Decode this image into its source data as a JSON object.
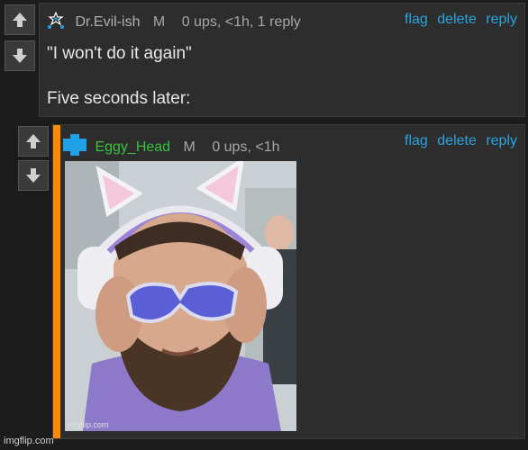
{
  "comment1": {
    "username": "Dr.Evil-ish",
    "badge": "M",
    "stats": "0 ups, <1h, 1 reply",
    "line1": "\"I won't do it again\"",
    "line2": "Five seconds later:",
    "actions": {
      "flag": "flag",
      "delete": "delete",
      "reply": "reply"
    }
  },
  "comment2": {
    "username": "Eggy_Head",
    "badge": "M",
    "stats": "0 ups, <1h",
    "actions": {
      "flag": "flag",
      "delete": "delete",
      "reply": "reply"
    },
    "image_watermark": "imgflip.com"
  },
  "footer": {
    "watermark": "imgflip.com"
  },
  "icons": {
    "upvote": "arrow-up-icon",
    "downvote": "arrow-down-icon",
    "avatar1": "star-cluster-icon",
    "avatar2": "plus-shape-icon"
  },
  "colors": {
    "link": "#2aa3e0",
    "username2": "#39c23e",
    "accent": "#ff8a00",
    "avatar2": "#1fa0e6"
  }
}
